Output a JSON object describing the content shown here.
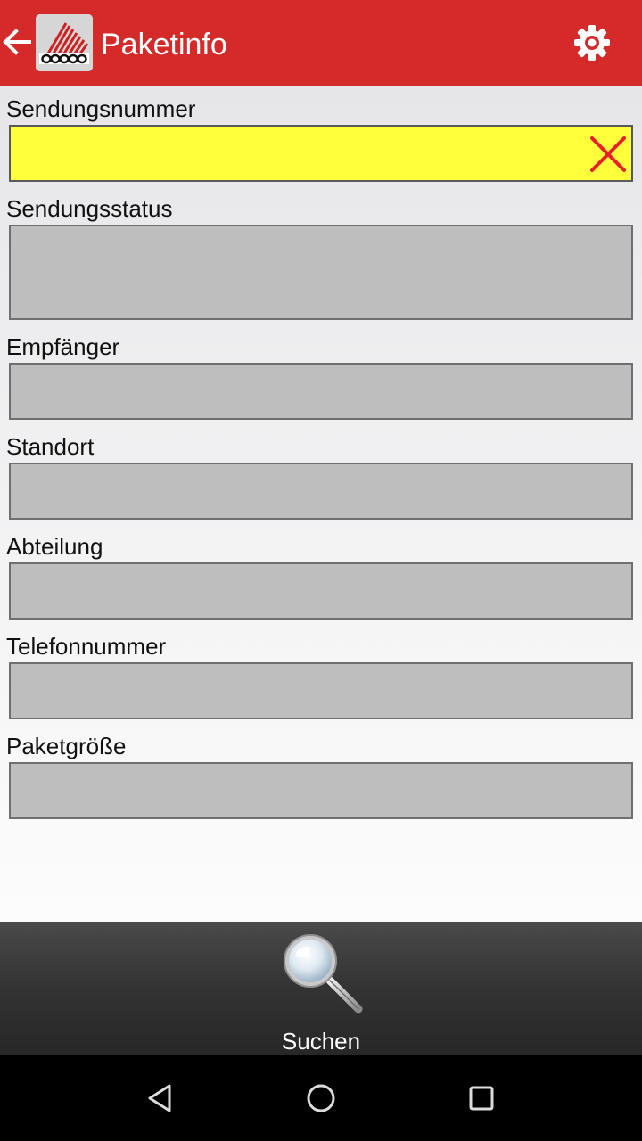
{
  "app_bar": {
    "title": "Paketinfo",
    "back_icon": "arrow-left-icon",
    "logo_icon": "app-logo",
    "settings_icon": "gear-icon",
    "colors": {
      "background": "#d42a2a",
      "text": "#ffffff"
    }
  },
  "form": {
    "fields": [
      {
        "label": "Sendungsnummer",
        "value": "",
        "active": true,
        "clear_icon": "close-icon"
      },
      {
        "label": "Sendungsstatus",
        "value": ""
      },
      {
        "label": "Empfänger",
        "value": ""
      },
      {
        "label": "Standort",
        "value": ""
      },
      {
        "label": "Abteilung",
        "value": ""
      },
      {
        "label": "Telefonnummer",
        "value": ""
      },
      {
        "label": "Paketgröße",
        "value": ""
      }
    ],
    "colors": {
      "active_field": "#ffff3c",
      "readonly_field": "#bebebe",
      "clear_icon": "#e8202a"
    }
  },
  "toolbar": {
    "search_label": "Suchen",
    "search_icon": "magnifier-icon"
  },
  "system_nav": {
    "back_icon": "triangle-back-icon",
    "home_icon": "circle-home-icon",
    "recents_icon": "square-recents-icon"
  }
}
